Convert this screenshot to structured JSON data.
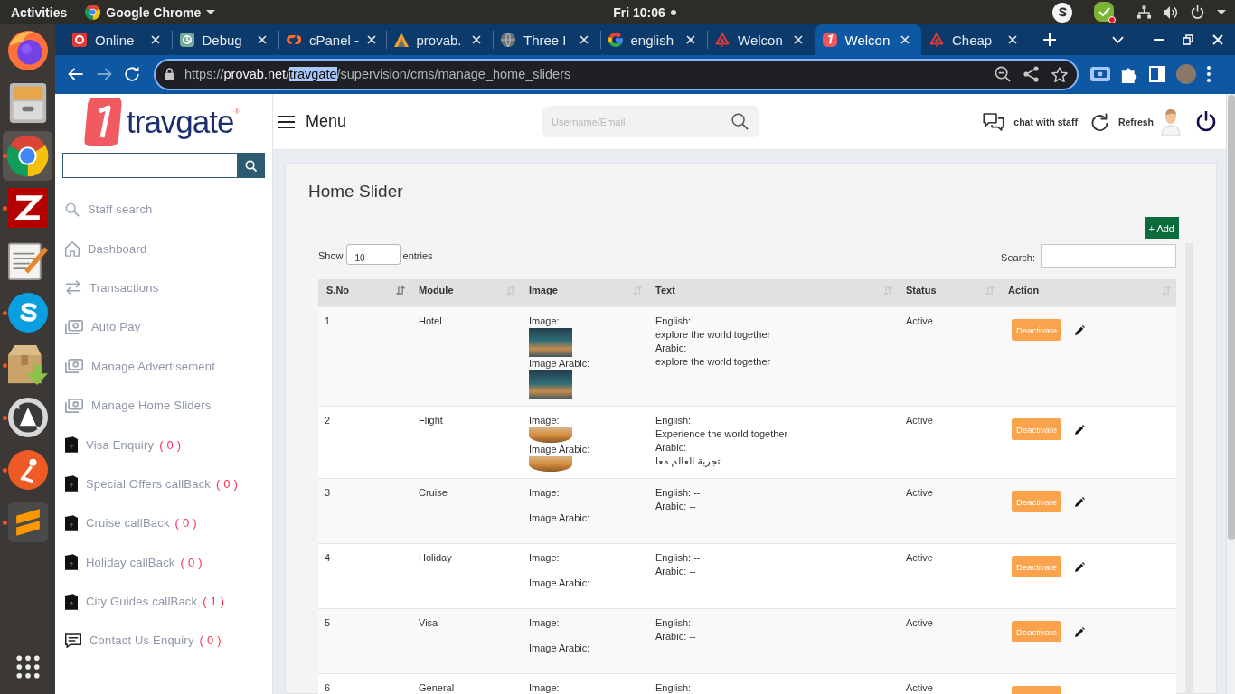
{
  "top_bar": {
    "activities": "Activities",
    "app_name": "Google Chrome",
    "clock": "Fri 10:06"
  },
  "dock": {
    "apps": [
      {
        "kind": "firefox",
        "running": false,
        "selected": false
      },
      {
        "kind": "files",
        "running": false,
        "selected": false
      },
      {
        "kind": "chrome",
        "running": true,
        "selected": true
      },
      {
        "kind": "filezilla",
        "running": true,
        "selected": false
      },
      {
        "kind": "editor",
        "running": false,
        "selected": false
      },
      {
        "kind": "skype",
        "running": true,
        "selected": false
      },
      {
        "kind": "archive",
        "running": true,
        "selected": false
      },
      {
        "kind": "updater",
        "running": true,
        "selected": false
      },
      {
        "kind": "postman",
        "running": true,
        "selected": false
      },
      {
        "kind": "sublime",
        "running": true,
        "selected": false
      }
    ]
  },
  "browser": {
    "tabs": [
      {
        "kind": "opal",
        "title": "Online",
        "selected": false
      },
      {
        "kind": "knot",
        "title": "Debug",
        "selected": false
      },
      {
        "kind": "cpanel",
        "title": "cPanel -",
        "selected": false
      },
      {
        "kind": "provab",
        "title": "provab.",
        "selected": false
      },
      {
        "kind": "globe",
        "title": "Three I",
        "selected": false
      },
      {
        "kind": "google",
        "title": "english",
        "selected": false
      },
      {
        "kind": "alert",
        "title": "Welcon",
        "selected": false
      },
      {
        "kind": "travgate",
        "title": "Welcon",
        "selected": true
      },
      {
        "kind": "alert",
        "title": "Cheap",
        "selected": false
      }
    ],
    "nav": [
      {
        "kind": "back",
        "disabled": false
      },
      {
        "kind": "forward",
        "disabled": true
      },
      {
        "kind": "reload",
        "disabled": false
      }
    ],
    "url": [
      {
        "text": "https://",
        "kind": "scheme",
        "selected": false
      },
      {
        "text": "provab.net",
        "kind": "host",
        "selected": false
      },
      {
        "text": "/",
        "kind": "path",
        "selected": false
      },
      {
        "text": "travgate",
        "kind": "path",
        "selected": true
      },
      {
        "text": "/supervision/cms/manage_home_sliders",
        "kind": "path",
        "selected": false
      }
    ]
  },
  "header": {
    "logo": "travgate",
    "trademark": "®",
    "menu": "Menu",
    "search": {
      "placeholder": "Username/Email"
    },
    "actions": [
      {
        "kind": "chat",
        "label": "chat with staff"
      },
      {
        "kind": "refresh",
        "label": "Refresh"
      }
    ]
  },
  "sidebar": {
    "items": [
      {
        "kind": "search",
        "label": "Staff search",
        "selected": false
      },
      {
        "kind": "home",
        "label": "Dashboard",
        "selected": false
      },
      {
        "kind": "swap",
        "label": "Transactions",
        "selected": false
      },
      {
        "kind": "cash",
        "label": "Auto Pay",
        "selected": false
      },
      {
        "kind": "cash",
        "label": "Manage Advertisement",
        "selected": false
      },
      {
        "kind": "cash",
        "label": "Manage Home Sliders",
        "selected": false
      },
      {
        "kind": "doc",
        "label": "Visa Enquiry",
        "count": "( 0 )",
        "selected": false
      },
      {
        "kind": "doc",
        "label": "Special Offers callBack",
        "count": "( 0 )",
        "selected": false
      },
      {
        "kind": "doc",
        "label": "Cruise callBack",
        "count": "( 0 )",
        "selected": false
      },
      {
        "kind": "doc",
        "label": "Holiday callBack",
        "count": "( 0 )",
        "selected": false
      },
      {
        "kind": "doc",
        "label": "City Guides callBack",
        "count": "( 1 )",
        "selected": false
      },
      {
        "kind": "chat",
        "label": "Contact Us Enquiry",
        "count": "( 0 )",
        "selected": false
      }
    ]
  },
  "content": {
    "title": "Home Slider",
    "add_button": "+ Add",
    "length": {
      "before": "Show",
      "value": "10",
      "after": "entries"
    },
    "search_label": "Search:",
    "table": {
      "columns": [
        {
          "label": "S.No",
          "sorted": true
        },
        {
          "label": "Module",
          "sorted": false
        },
        {
          "label": "Image",
          "sorted": false
        },
        {
          "label": "Text",
          "sorted": false
        },
        {
          "label": "Status",
          "sorted": false
        },
        {
          "label": "Action",
          "sorted": false
        }
      ],
      "rows": [
        {
          "sno": "1",
          "module": "Hotel",
          "images": [
            {
              "label": "Image:",
              "kind": "photo"
            },
            {
              "label": "Image Arabic:",
              "kind": "photo"
            }
          ],
          "text": [
            "English:",
            "explore the world together",
            "Arabic:",
            "explore the world together"
          ],
          "status": "Active",
          "action": {
            "label": "Deactivate",
            "edit": true
          }
        },
        {
          "sno": "2",
          "module": "Flight",
          "images": [
            {
              "label": "Image:",
              "kind": "banner"
            },
            {
              "label": "Image Arabic:",
              "kind": "banner"
            }
          ],
          "text": [
            "English:",
            "Experience the world together",
            "Arabic:",
            "تجربة العالم معا"
          ],
          "status": "Active",
          "action": {
            "label": "Deactivate",
            "edit": true
          }
        },
        {
          "sno": "3",
          "module": "Cruise",
          "images": [
            {
              "label": "Image:",
              "kind": "empty"
            },
            {
              "label": "Image Arabic:",
              "kind": "empty"
            }
          ],
          "text": [
            "English: --",
            "Arabic: --"
          ],
          "status": "Active",
          "action": {
            "label": "Deactivate",
            "edit": true
          }
        },
        {
          "sno": "4",
          "module": "Holiday",
          "images": [
            {
              "label": "Image:",
              "kind": "empty"
            },
            {
              "label": "Image Arabic:",
              "kind": "empty"
            }
          ],
          "text": [
            "English: --",
            "Arabic: --"
          ],
          "status": "Active",
          "action": {
            "label": "Deactivate",
            "edit": true
          }
        },
        {
          "sno": "5",
          "module": "Visa",
          "images": [
            {
              "label": "Image:",
              "kind": "empty"
            },
            {
              "label": "Image Arabic:",
              "kind": "empty"
            }
          ],
          "text": [
            "English: --",
            "Arabic: --"
          ],
          "status": "Active",
          "action": {
            "label": "Deactivate",
            "edit": true
          }
        },
        {
          "sno": "6",
          "module": "General",
          "images": [
            {
              "label": "Image:",
              "kind": "empty"
            }
          ],
          "text": [
            "English: --"
          ],
          "status": "Active",
          "action": {
            "edit": false
          }
        }
      ]
    }
  }
}
